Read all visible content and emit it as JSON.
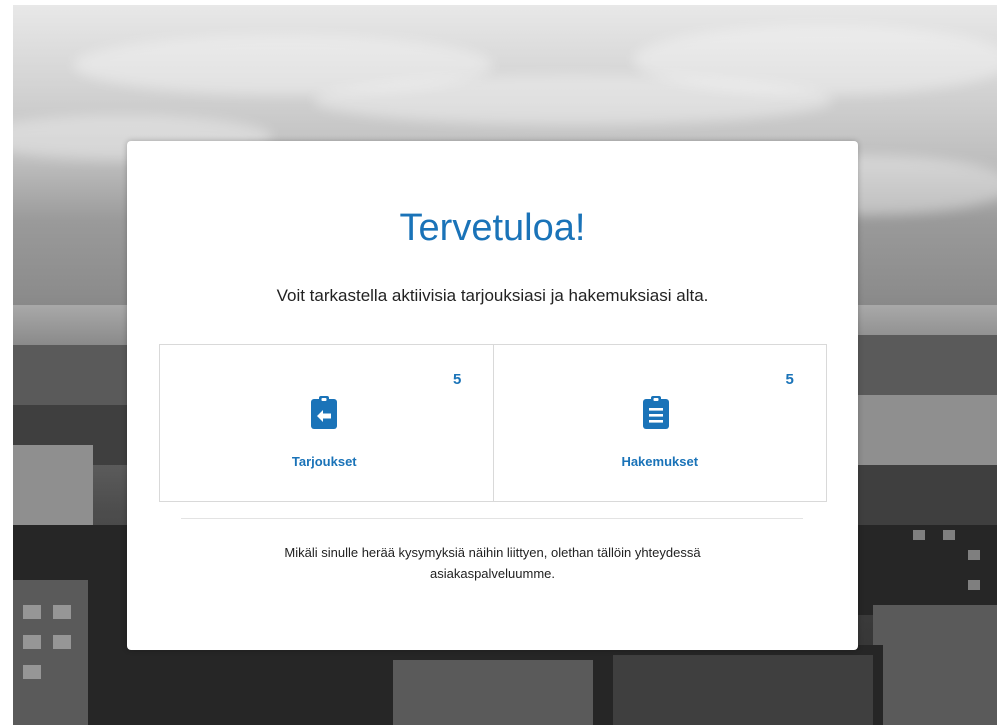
{
  "welcome": {
    "title": "Tervetuloa!",
    "subtitle": "Voit tarkastella aktiivisia tarjouksiasi ja hakemuksiasi alta."
  },
  "tiles": [
    {
      "label": "Tarjoukset",
      "count": "5",
      "icon": "clipboard-arrow-left-icon"
    },
    {
      "label": "Hakemukset",
      "count": "5",
      "icon": "clipboard-list-icon"
    }
  ],
  "footer": {
    "line1": "Mikäli sinulle herää kysymyksiä näihin liittyen, olethan tällöin yhteydessä",
    "line2": "asiakaspalveluumme."
  },
  "colors": {
    "accent": "#1a73b8",
    "card_background": "#ffffff",
    "text": "#222222"
  }
}
